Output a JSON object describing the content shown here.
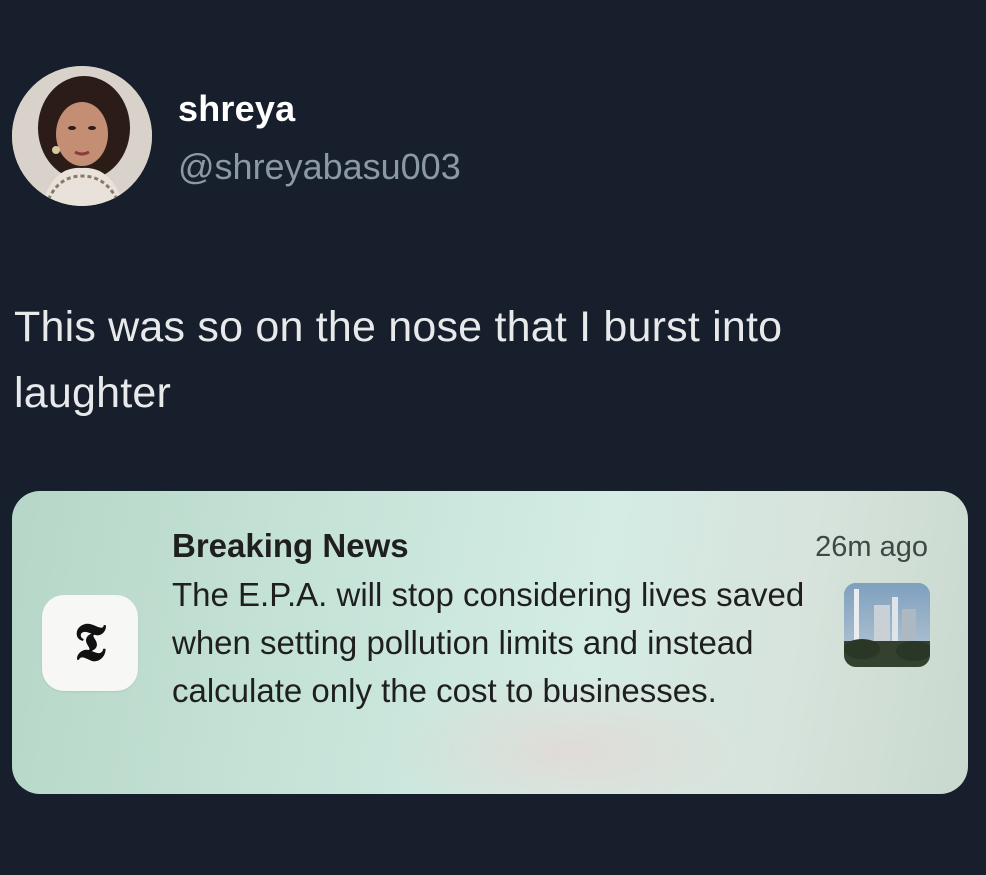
{
  "tweet": {
    "author": {
      "display_name": "shreya",
      "handle": "@shreyabasu003",
      "avatar_icon": "profile-photo"
    },
    "text": "This was so on the nose that I burst into laughter"
  },
  "notification": {
    "app_icon": "nyt-t-logo",
    "app_icon_glyph": "𝕿",
    "title": "Breaking News",
    "time": "26m ago",
    "body": "The E.P.A. will stop considering lives saved when setting pollution limits and instead calculate only the cost to businesses.",
    "thumbnail_icon": "power-plant-photo"
  },
  "colors": {
    "background": "#15202b",
    "name": "#ffffff",
    "handle": "#8b98a5",
    "text": "#e7e9ea",
    "card": "#c7e4d9"
  }
}
